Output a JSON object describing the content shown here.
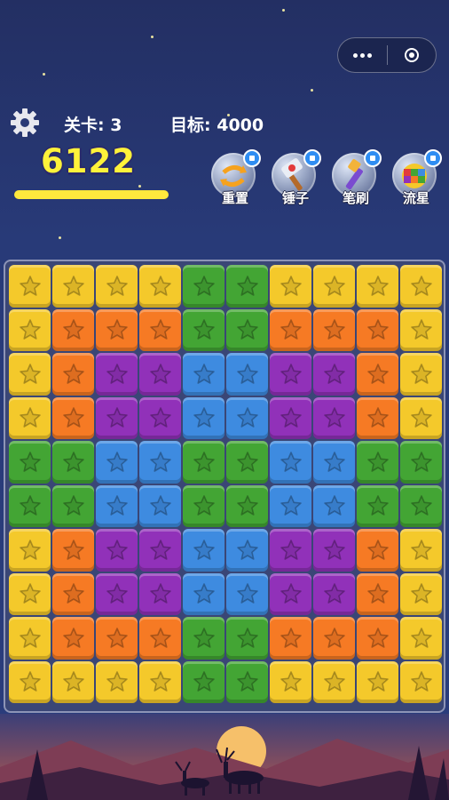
{
  "capsule": {
    "menu_icon": "more-dots-icon",
    "close_icon": "target-ring-icon"
  },
  "hud": {
    "settings_icon": "gear-icon",
    "level_label": "关卡:",
    "level_value": "3",
    "target_label": "目标:",
    "target_value": "4000",
    "score": "6122",
    "progress": 1.0
  },
  "tools": [
    {
      "name": "reset",
      "label": "重置",
      "icon": "shuffle-icon"
    },
    {
      "name": "hammer",
      "label": "锤子",
      "icon": "hammer-icon"
    },
    {
      "name": "brush",
      "label": "笔刷",
      "icon": "brush-icon"
    },
    {
      "name": "meteor",
      "label": "流星",
      "icon": "meteor-icon"
    }
  ],
  "board": {
    "rows": [
      [
        "Y",
        "Y",
        "Y",
        "Y",
        "G",
        "G",
        "Y",
        "Y",
        "Y",
        "Y"
      ],
      [
        "Y",
        "O",
        "O",
        "O",
        "G",
        "G",
        "O",
        "O",
        "O",
        "Y"
      ],
      [
        "Y",
        "O",
        "P",
        "P",
        "B",
        "B",
        "P",
        "P",
        "O",
        "Y"
      ],
      [
        "Y",
        "O",
        "P",
        "P",
        "B",
        "B",
        "P",
        "P",
        "O",
        "Y"
      ],
      [
        "G",
        "G",
        "B",
        "B",
        "G",
        "G",
        "B",
        "B",
        "G",
        "G"
      ],
      [
        "G",
        "G",
        "B",
        "B",
        "G",
        "G",
        "B",
        "B",
        "G",
        "G"
      ],
      [
        "Y",
        "O",
        "P",
        "P",
        "B",
        "B",
        "P",
        "P",
        "O",
        "Y"
      ],
      [
        "Y",
        "O",
        "P",
        "P",
        "B",
        "B",
        "P",
        "P",
        "O",
        "Y"
      ],
      [
        "Y",
        "O",
        "O",
        "O",
        "G",
        "G",
        "O",
        "O",
        "O",
        "Y"
      ],
      [
        "Y",
        "Y",
        "Y",
        "Y",
        "G",
        "G",
        "Y",
        "Y",
        "Y",
        "Y"
      ]
    ],
    "legend": {
      "Y": "yellow",
      "O": "orange",
      "G": "green",
      "B": "blue",
      "P": "purple"
    },
    "colors": {
      "yellow": "#f4c92b",
      "orange": "#f67a24",
      "green": "#43a534",
      "blue": "#3e8be0",
      "purple": "#9131b9"
    }
  }
}
